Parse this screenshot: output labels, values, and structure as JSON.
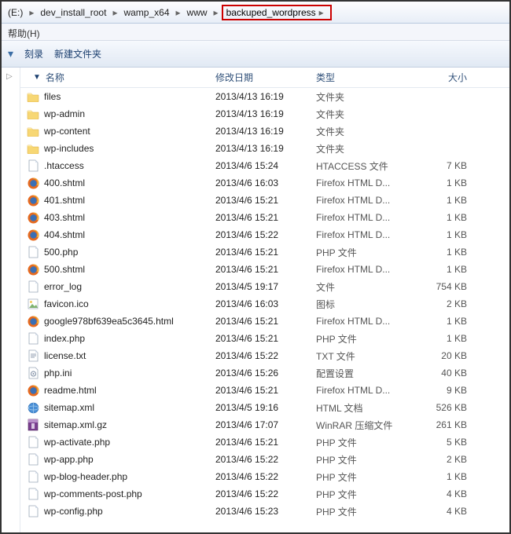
{
  "breadcrumb": [
    {
      "label": "(E:)"
    },
    {
      "label": "dev_install_root"
    },
    {
      "label": "wamp_x64"
    },
    {
      "label": "www"
    },
    {
      "label": "backuped_wordpress",
      "highlight": true
    }
  ],
  "menubar": {
    "help": "帮助(H)"
  },
  "toolbar": {
    "burn": "刻录",
    "new_folder": "新建文件夹"
  },
  "columns": {
    "name": "名称",
    "date": "修改日期",
    "type": "类型",
    "size": "大小"
  },
  "files": [
    {
      "icon": "folder",
      "name": "files",
      "date": "2013/4/13 16:19",
      "type": "文件夹",
      "size": ""
    },
    {
      "icon": "folder",
      "name": "wp-admin",
      "date": "2013/4/13 16:19",
      "type": "文件夹",
      "size": ""
    },
    {
      "icon": "folder",
      "name": "wp-content",
      "date": "2013/4/13 16:19",
      "type": "文件夹",
      "size": ""
    },
    {
      "icon": "folder",
      "name": "wp-includes",
      "date": "2013/4/13 16:19",
      "type": "文件夹",
      "size": ""
    },
    {
      "icon": "file",
      "name": ".htaccess",
      "date": "2013/4/6 15:24",
      "type": "HTACCESS 文件",
      "size": "7 KB"
    },
    {
      "icon": "firefox",
      "name": "400.shtml",
      "date": "2013/4/6 16:03",
      "type": "Firefox HTML D...",
      "size": "1 KB"
    },
    {
      "icon": "firefox",
      "name": "401.shtml",
      "date": "2013/4/6 15:21",
      "type": "Firefox HTML D...",
      "size": "1 KB"
    },
    {
      "icon": "firefox",
      "name": "403.shtml",
      "date": "2013/4/6 15:21",
      "type": "Firefox HTML D...",
      "size": "1 KB"
    },
    {
      "icon": "firefox",
      "name": "404.shtml",
      "date": "2013/4/6 15:22",
      "type": "Firefox HTML D...",
      "size": "1 KB"
    },
    {
      "icon": "file",
      "name": "500.php",
      "date": "2013/4/6 15:21",
      "type": "PHP 文件",
      "size": "1 KB"
    },
    {
      "icon": "firefox",
      "name": "500.shtml",
      "date": "2013/4/6 15:21",
      "type": "Firefox HTML D...",
      "size": "1 KB"
    },
    {
      "icon": "file",
      "name": "error_log",
      "date": "2013/4/5 19:17",
      "type": "文件",
      "size": "754 KB"
    },
    {
      "icon": "ico",
      "name": "favicon.ico",
      "date": "2013/4/6 16:03",
      "type": "图标",
      "size": "2 KB"
    },
    {
      "icon": "firefox",
      "name": "google978bf639ea5c3645.html",
      "date": "2013/4/6 15:21",
      "type": "Firefox HTML D...",
      "size": "1 KB"
    },
    {
      "icon": "file",
      "name": "index.php",
      "date": "2013/4/6 15:21",
      "type": "PHP 文件",
      "size": "1 KB"
    },
    {
      "icon": "txt",
      "name": "license.txt",
      "date": "2013/4/6 15:22",
      "type": "TXT 文件",
      "size": "20 KB"
    },
    {
      "icon": "ini",
      "name": "php.ini",
      "date": "2013/4/6 15:26",
      "type": "配置设置",
      "size": "40 KB"
    },
    {
      "icon": "firefox",
      "name": "readme.html",
      "date": "2013/4/6 15:21",
      "type": "Firefox HTML D...",
      "size": "9 KB"
    },
    {
      "icon": "html",
      "name": "sitemap.xml",
      "date": "2013/4/5 19:16",
      "type": "HTML 文档",
      "size": "526 KB"
    },
    {
      "icon": "rar",
      "name": "sitemap.xml.gz",
      "date": "2013/4/6 17:07",
      "type": "WinRAR 压缩文件",
      "size": "261 KB"
    },
    {
      "icon": "file",
      "name": "wp-activate.php",
      "date": "2013/4/6 15:21",
      "type": "PHP 文件",
      "size": "5 KB"
    },
    {
      "icon": "file",
      "name": "wp-app.php",
      "date": "2013/4/6 15:22",
      "type": "PHP 文件",
      "size": "2 KB"
    },
    {
      "icon": "file",
      "name": "wp-blog-header.php",
      "date": "2013/4/6 15:22",
      "type": "PHP 文件",
      "size": "1 KB"
    },
    {
      "icon": "file",
      "name": "wp-comments-post.php",
      "date": "2013/4/6 15:22",
      "type": "PHP 文件",
      "size": "4 KB"
    },
    {
      "icon": "file",
      "name": "wp-config.php",
      "date": "2013/4/6 15:23",
      "type": "PHP 文件",
      "size": "4 KB"
    }
  ]
}
